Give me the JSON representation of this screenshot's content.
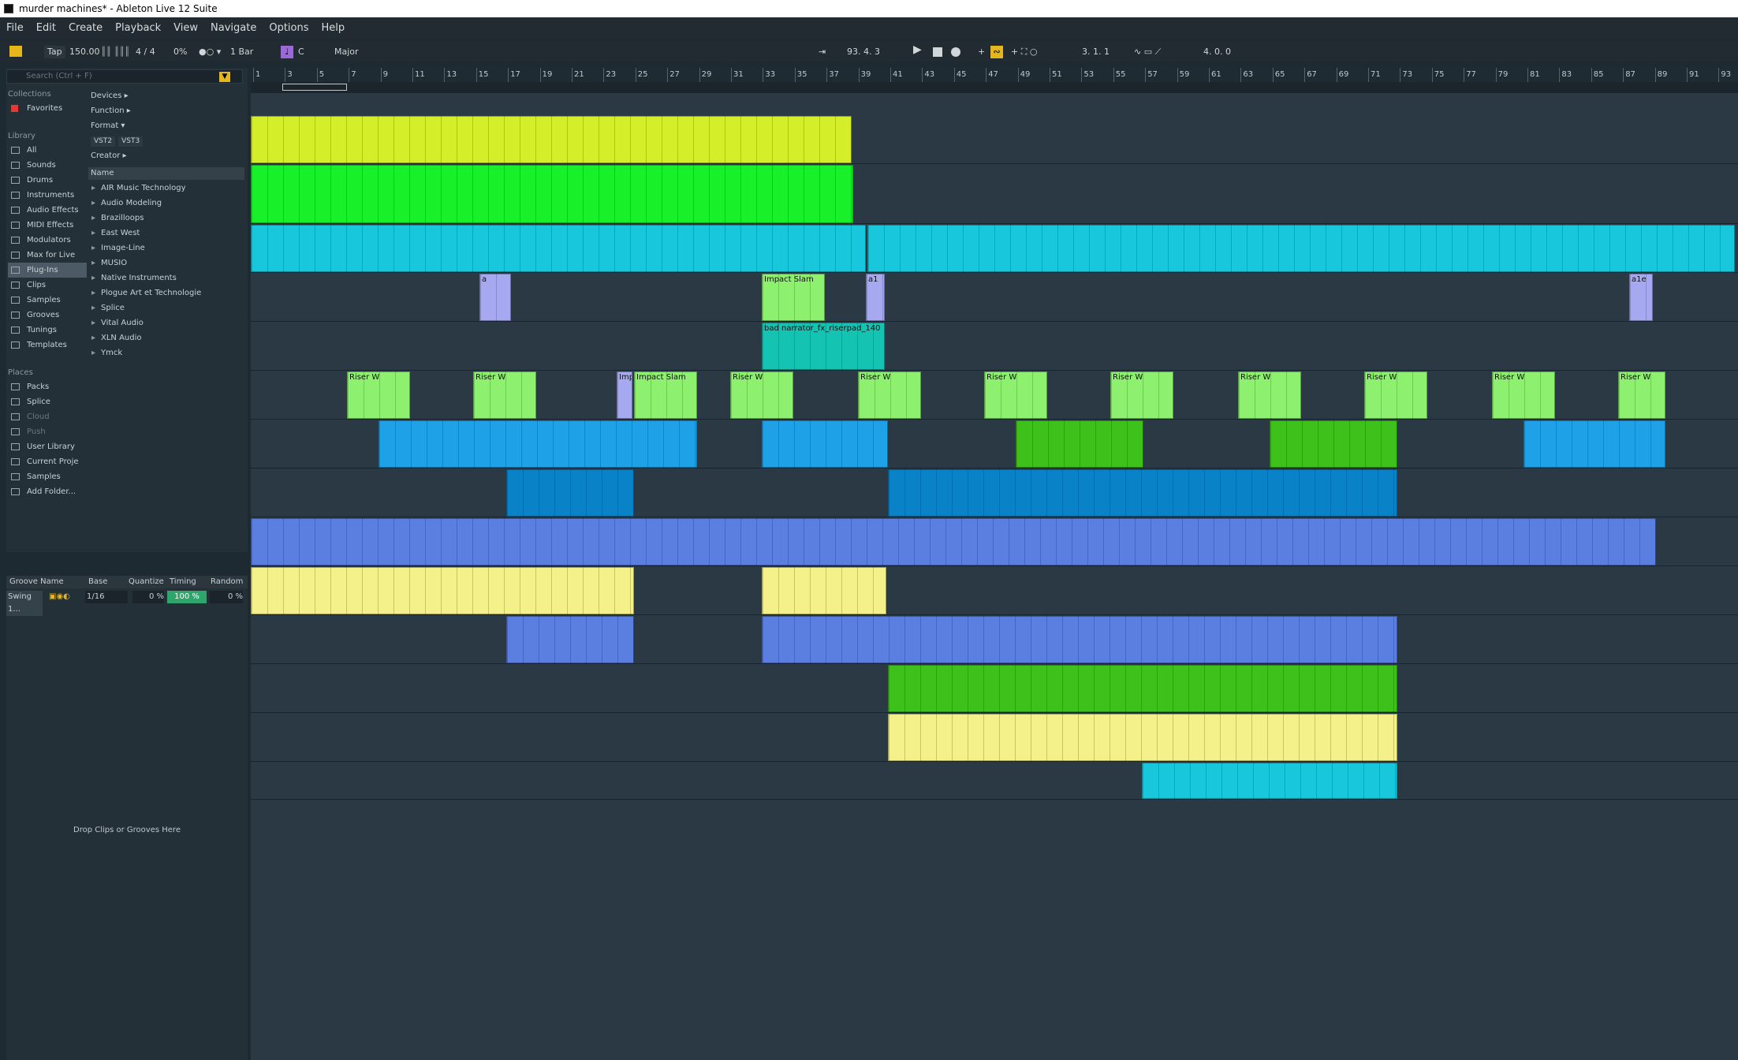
{
  "window": {
    "title": "murder machines* - Ableton Live 12 Suite"
  },
  "menu": [
    "File",
    "Edit",
    "Create",
    "Playback",
    "View",
    "Navigate",
    "Options",
    "Help"
  ],
  "transport": {
    "tap": "Tap",
    "tempo": "150.00",
    "signature": "4 / 4",
    "swing": "0%",
    "quantize": "1 Bar",
    "key": "C",
    "scale": "Major",
    "position": "93.  4.  3",
    "loop_start": "3.  1.  1",
    "loop_length": "4.  0.  0"
  },
  "browser": {
    "search_placeholder": "Search (Ctrl + F)",
    "collections_label": "Collections",
    "favorites": "Favorites",
    "library_label": "Library",
    "library": [
      "All",
      "Sounds",
      "Drums",
      "Instruments",
      "Audio Effects",
      "MIDI Effects",
      "Modulators",
      "Max for Live",
      "Plug-Ins",
      "Clips",
      "Samples",
      "Grooves",
      "Tunings",
      "Templates"
    ],
    "places_label": "Places",
    "places": [
      "Packs",
      "Splice",
      "Cloud",
      "Push",
      "User Library",
      "Current Proje",
      "Samples",
      "Add Folder..."
    ],
    "filters": {
      "devices": "Devices ▸",
      "function": "Function ▸",
      "format": "Format ▾",
      "vst2": "VST2",
      "vst3": "VST3",
      "creator": "Creator ▸"
    },
    "name_header": "Name",
    "plugins": [
      "AIR Music Technology",
      "Audio Modeling",
      "Brazilloops",
      "East West",
      "Image-Line",
      "MUSIO",
      "Native Instruments",
      "Plogue Art et Technologie",
      "Splice",
      "Vital Audio",
      "XLN Audio",
      "Ymck"
    ]
  },
  "groove": {
    "headers": {
      "name": "Groove Name",
      "base": "Base",
      "quantize": "Quantize",
      "timing": "Timing",
      "random": "Random"
    },
    "row": {
      "name": "Swing 1...",
      "base": "1/16",
      "quantize": "0 %",
      "timing": "100 %",
      "random": "0 %"
    },
    "drop": "Drop Clips or Grooves Here"
  },
  "ruler": [
    "1",
    "3",
    "5",
    "7",
    "9",
    "11",
    "13",
    "15",
    "17",
    "19",
    "21",
    "23",
    "25",
    "27",
    "29",
    "31",
    "33",
    "35",
    "37",
    "39",
    "41",
    "43",
    "45",
    "47",
    "49",
    "51",
    "53",
    "55",
    "57",
    "59",
    "61",
    "63",
    "65",
    "67",
    "69",
    "71",
    "73",
    "75",
    "77",
    "79",
    "81",
    "83",
    "85",
    "87",
    "89",
    "91",
    "93"
  ],
  "clip_labels": {
    "impact": "Impact Slam",
    "riser_pad": "bad narrator_fx_riserpad_140",
    "riser": "Riser W",
    "imp": "Imp",
    "a": "a",
    "a1": "a1",
    "a1e": "a1e"
  },
  "colors": {
    "lime": "#d4ef2a",
    "green": "#18f02a",
    "cyan": "#18c7dc",
    "lavender": "#a7a9f0",
    "lightgreen": "#8df06e",
    "teal": "#15c3b2",
    "azure": "#1fa1e8",
    "darkgreen": "#3ec21b",
    "blue": "#0a82c8",
    "royal": "#5a7fe0",
    "yellow": "#f4f08a"
  }
}
